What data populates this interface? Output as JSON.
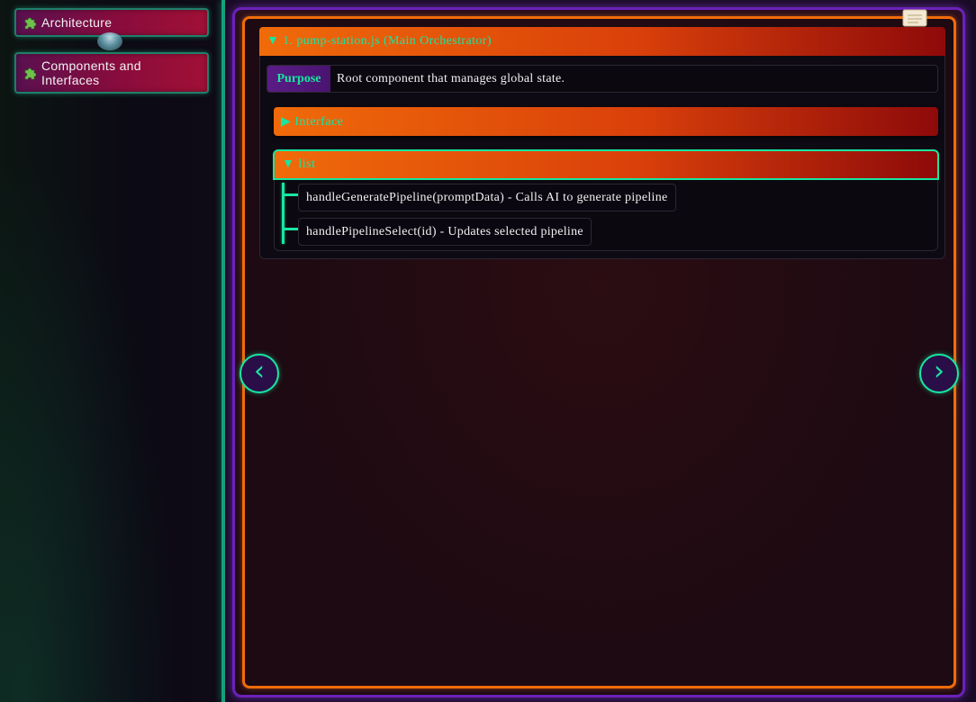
{
  "sidebar": {
    "items": [
      {
        "label": "Architecture",
        "icon": "puzzle-icon"
      },
      {
        "label": "Components and Interfaces",
        "icon": "puzzle-icon"
      }
    ]
  },
  "section": {
    "title": "▼ 1. pump-station.js (Main Orchestrator)",
    "purpose_label": "Purpose",
    "purpose_text": "Root component that manages global state.",
    "interface_header": "▶ Interface",
    "list_header": "▼ list",
    "list_items": [
      "handleGeneratePipeline(promptData) - Calls AI to generate pipeline",
      "handlePipelineSelect(id) - Updates selected pipeline"
    ]
  },
  "nav": {
    "prev": "‹",
    "next": "›"
  },
  "colors": {
    "accent_green": "#18e6a0",
    "orange": "#f06a0a",
    "purple_border": "#6a22b8"
  }
}
